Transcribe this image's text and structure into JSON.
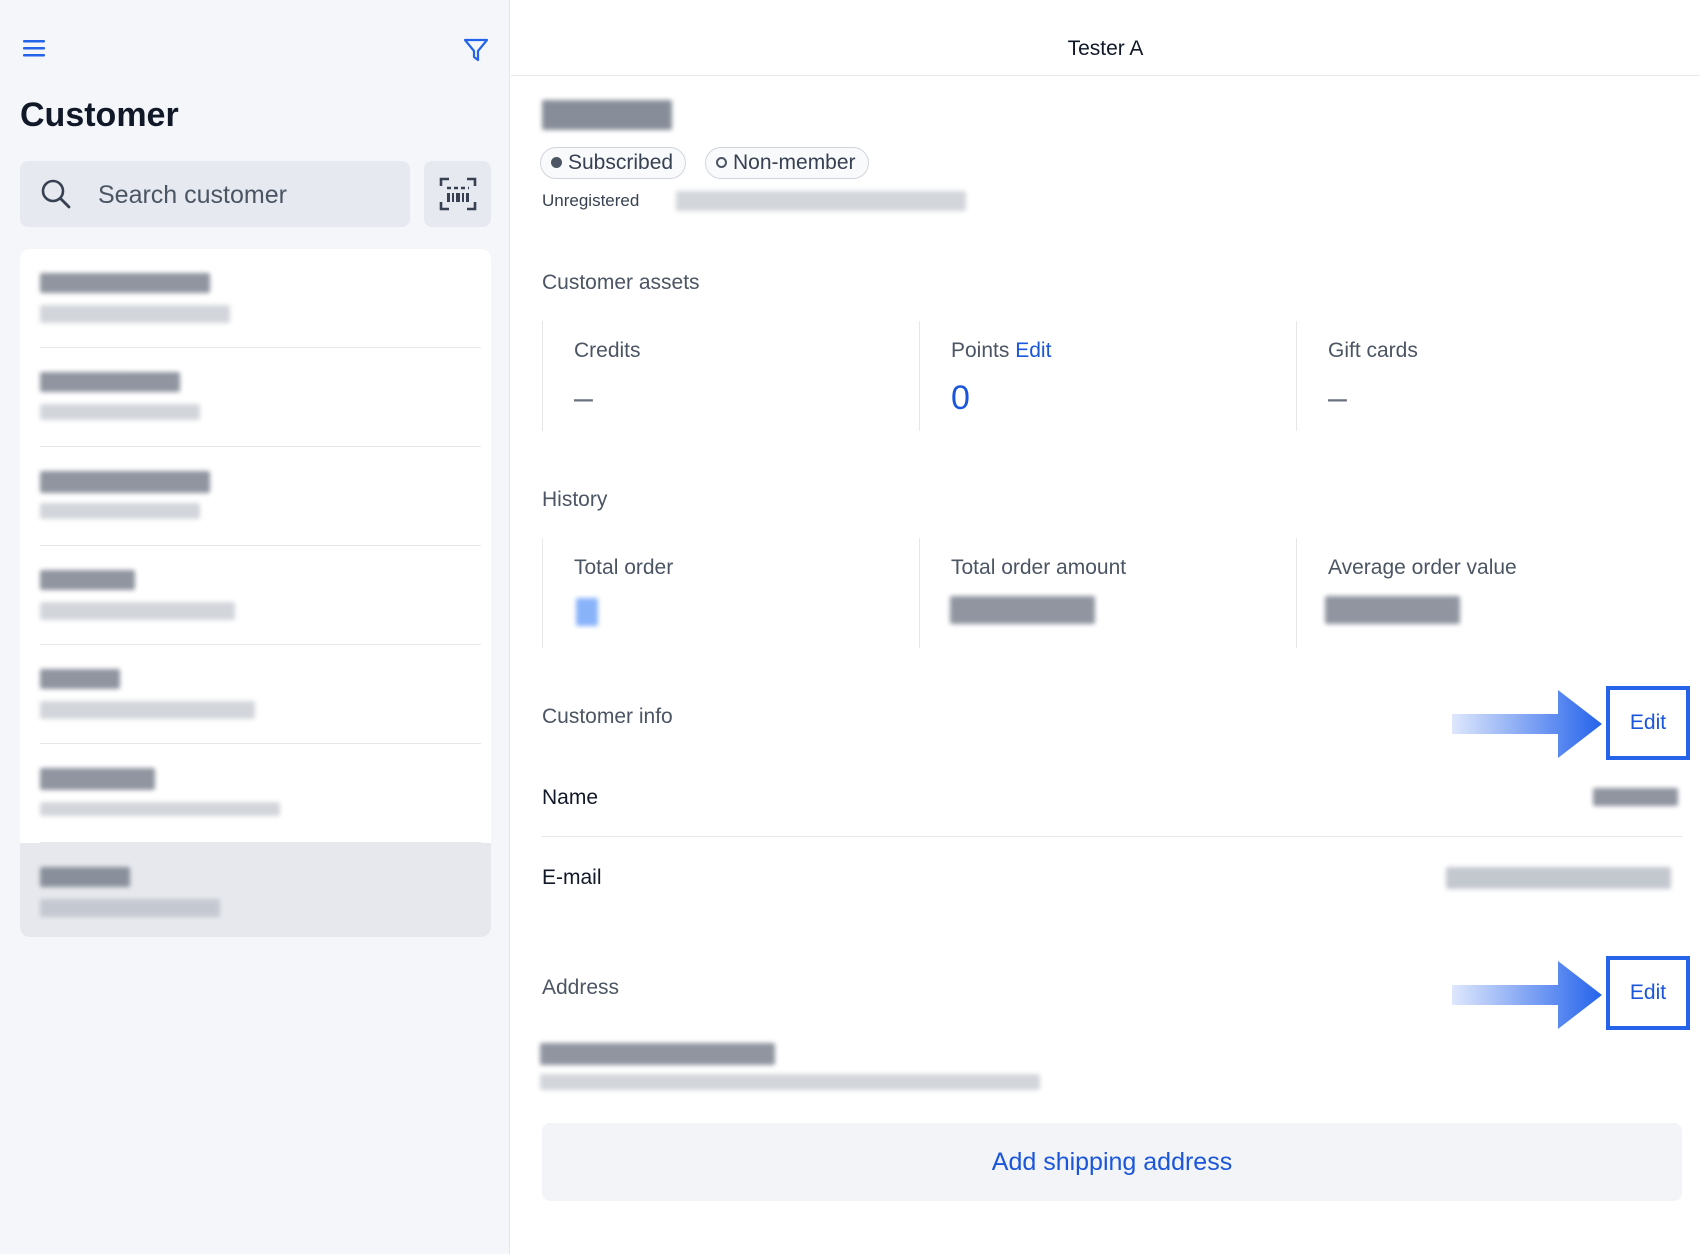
{
  "sidebar": {
    "menu_icon": "hamburger-menu-icon",
    "filter_icon": "filter-funnel-icon",
    "title": "Customer",
    "search": {
      "placeholder": "Search customer",
      "value": ""
    },
    "scan_icon": "barcode-scan-icon",
    "customers": [
      {
        "selected": false
      },
      {
        "selected": false
      },
      {
        "selected": false
      },
      {
        "selected": false
      },
      {
        "selected": false
      },
      {
        "selected": false
      },
      {
        "selected": true
      }
    ]
  },
  "header": {
    "title": "Tester A"
  },
  "customer": {
    "badges": [
      {
        "label": "Subscribed",
        "icon": "filled-dot-icon"
      },
      {
        "label": "Non-member",
        "icon": "empty-dot-icon"
      }
    ],
    "registration_status": "Unregistered"
  },
  "assets": {
    "title": "Customer assets",
    "credits": {
      "label": "Credits",
      "value": "–"
    },
    "points": {
      "label": "Points",
      "edit_label": "Edit",
      "value": "0"
    },
    "gift_cards": {
      "label": "Gift cards",
      "value": "–"
    }
  },
  "history": {
    "title": "History",
    "total_order": {
      "label": "Total order"
    },
    "total_order_amount": {
      "label": "Total order amount"
    },
    "average_order_value": {
      "label": "Average order value"
    }
  },
  "customer_info": {
    "title": "Customer info",
    "edit_label": "Edit",
    "name_label": "Name",
    "email_label": "E-mail"
  },
  "address": {
    "title": "Address",
    "edit_label": "Edit",
    "add_shipping_label": "Add shipping address"
  },
  "colors": {
    "accent": "#1a56db",
    "highlight_border": "#2563eb",
    "sidebar_bg": "#f4f6fa",
    "selected_row": "#e6e8ed"
  }
}
